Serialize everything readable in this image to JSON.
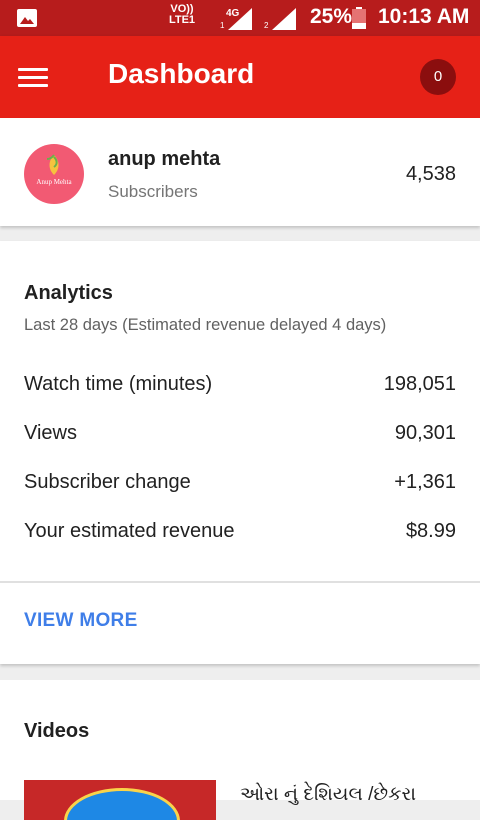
{
  "status_bar": {
    "network_label": "VO)) LTE1",
    "network_type": "4G",
    "sim1": "1",
    "sim2": "2",
    "battery": "25%",
    "time": "10:13 AM"
  },
  "app_bar": {
    "title": "Dashboard",
    "notification_count": "0"
  },
  "channel": {
    "avatar_text": "Anup Mehta",
    "name": "anup mehta",
    "subscribers_label": "Subscribers",
    "subscriber_count": "4,538"
  },
  "analytics": {
    "title": "Analytics",
    "subtitle": "Last 28 days (Estimated revenue delayed 4 days)",
    "metrics": [
      {
        "label": "Watch time (minutes)",
        "value": "198,051"
      },
      {
        "label": "Views",
        "value": "90,301"
      },
      {
        "label": "Subscriber change",
        "value": "+1,361"
      },
      {
        "label": "Your estimated revenue",
        "value": "$8.99"
      }
    ],
    "view_more": "VIEW MORE"
  },
  "videos": {
    "title": "Videos",
    "first_video_title": "ઓરા નું દેશિયલ /છેકરા"
  },
  "colors": {
    "status_bar": "#b71c1c",
    "app_bar": "#e62117",
    "badge": "#8b0e0e",
    "avatar": "#f25a73",
    "link": "#3f7ee8"
  },
  "icons": {
    "status_left": "gallery-icon",
    "menu": "menu-icon",
    "battery": "battery-icon",
    "signal": "signal-icon"
  }
}
